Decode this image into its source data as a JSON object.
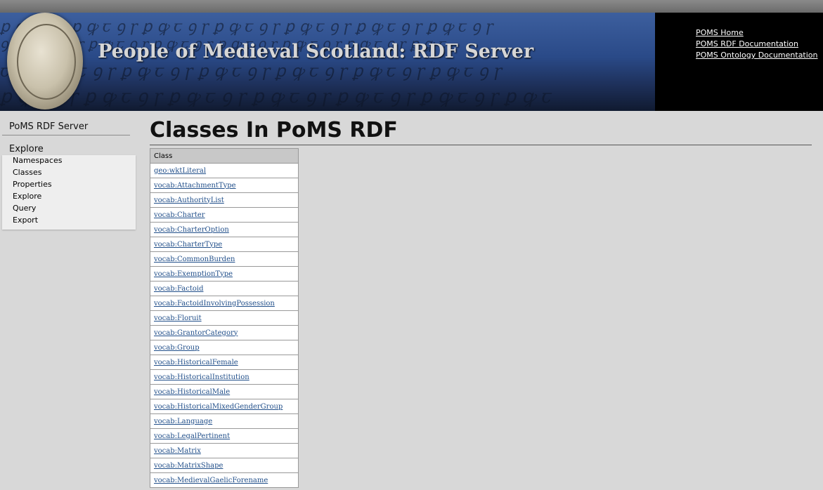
{
  "banner": {
    "title": "People of Medieval Scotland: RDF Server",
    "links": [
      "POMS Home",
      "POMS RDF Documentation",
      "POMS Ontology Documentation"
    ]
  },
  "sidebar": {
    "heading": "PoMS RDF Server",
    "section": "Explore",
    "items": [
      "Namespaces",
      "Classes",
      "Properties",
      "Explore",
      "Query",
      "Export"
    ]
  },
  "main": {
    "title": "Classes In PoMS RDF",
    "table": {
      "header": "Class",
      "rows": [
        "geo:wktLiteral",
        "vocab:AttachmentType",
        "vocab:AuthorityList",
        "vocab:Charter",
        "vocab:CharterOption",
        "vocab:CharterType",
        "vocab:CommonBurden",
        "vocab:ExemptionType",
        "vocab:Factoid",
        "vocab:FactoidInvolvingPossession",
        "vocab:Floruit",
        "vocab:GrantorCategory",
        "vocab:Group",
        "vocab:HistoricalFemale",
        "vocab:HistoricalInstitution",
        "vocab:HistoricalMale",
        "vocab:HistoricalMixedGenderGroup",
        "vocab:Language",
        "vocab:LegalPertinent",
        "vocab:Matrix",
        "vocab:MatrixShape",
        "vocab:MedievalGaelicForename"
      ]
    }
  },
  "colors": {
    "background": "#d8d8d8",
    "banner_blue": "#2a4a88",
    "link": "#214f8a"
  }
}
